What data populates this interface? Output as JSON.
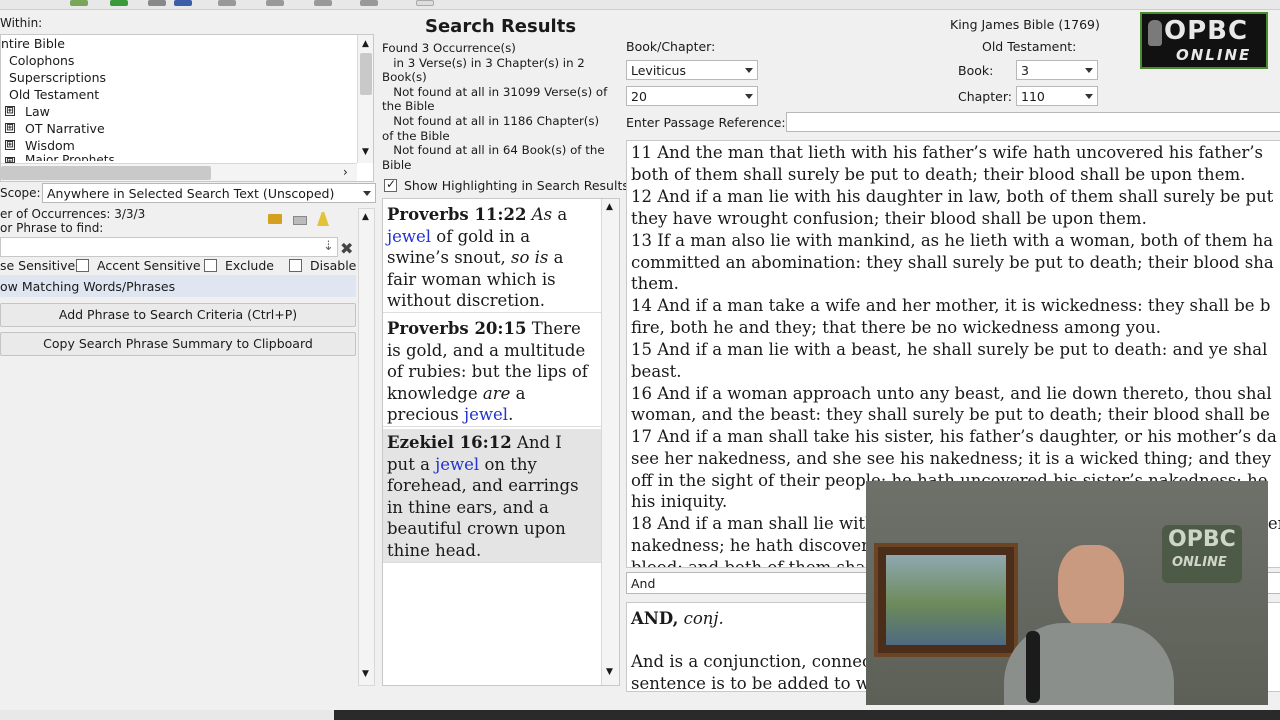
{
  "left": {
    "within_label": "Within:",
    "tree": [
      {
        "label": "ntire Bible",
        "marker": ""
      },
      {
        "label": "Colophons",
        "marker": ""
      },
      {
        "label": "Superscriptions",
        "marker": ""
      },
      {
        "label": "Old Testament",
        "marker": ""
      },
      {
        "label": "Law",
        "marker": "⊞"
      },
      {
        "label": "OT Narrative",
        "marker": "⊞"
      },
      {
        "label": "Wisdom",
        "marker": "⊞"
      },
      {
        "label": "Major Prophets",
        "marker": "⊞"
      }
    ],
    "scope_label": "Scope:",
    "scope_value": "Anywhere in Selected Search Text (Unscoped)",
    "occurrences_label": "er of Occurrences: 3/3/3",
    "phrase_label": "or Phrase to find:",
    "phrase_value": "",
    "options": {
      "case_sensitive": "se Sensitive",
      "accent_sensitive": "Accent Sensitive",
      "exclude": "Exclude",
      "disable": "Disable"
    },
    "matching_words": "ow Matching Words/Phrases",
    "add_phrase_button": "Add Phrase to Search Criteria (Ctrl+P)",
    "copy_summary_button": "Copy Search Phrase Summary to Clipboard"
  },
  "middle": {
    "title": "Search Results",
    "summary": [
      "Found 3 Occurrence(s)",
      "   in 3 Verse(s) in 3 Chapter(s) in 2",
      "Book(s)",
      "   Not found at all in 31099 Verse(s) of",
      "the Bible",
      "   Not found at all in 1186 Chapter(s)",
      "of the Bible",
      "   Not found at all in 64 Book(s) of the",
      "Bible"
    ],
    "show_highlighting": "Show Highlighting in Search Results",
    "results": [
      {
        "ref": "Proverbs 11:22",
        "lines": [
          [
            "",
            "As a"
          ],
          [
            "jewel",
            " of gold in a"
          ],
          [
            "",
            "swine’s snout, so is a"
          ],
          [
            "",
            "fair woman which is"
          ],
          [
            "",
            "without discretion."
          ]
        ]
      },
      {
        "ref": "Proverbs 20:15",
        "lines": [
          [
            "",
            "There"
          ],
          [
            "",
            "is gold, and a multitude"
          ],
          [
            "",
            "of rubies: but the lips of"
          ],
          [
            "",
            "knowledge are a"
          ],
          [
            "",
            "precious jewel."
          ]
        ]
      },
      {
        "ref": "Ezekiel 16:12",
        "lines": [
          [
            "",
            "And I"
          ],
          [
            "",
            "put a jewel on thy"
          ],
          [
            "",
            "forehead, and earrings"
          ],
          [
            "",
            "in thine ears, and a"
          ],
          [
            "",
            "beautiful crown upon"
          ],
          [
            "",
            "thine head."
          ]
        ]
      }
    ]
  },
  "right": {
    "version_title": "King James Bible (1769)",
    "book_chapter_label": "Book/Chapter:",
    "book_value": "Leviticus",
    "chapter_value": "20",
    "testament_label": "Old Testament:",
    "book_label": "Book:",
    "book_number": "3",
    "chapter_label": "Chapter:",
    "chapter_number": "110",
    "passage_label": "Enter Passage Reference:",
    "passage_value": "",
    "verses": [
      "11 And the man that lieth with his father’s wife hath uncovered his father’s",
      "both of them shall surely be put to death; their blood shall be upon them.",
      "12 And if a man lie with his daughter in law, both of them shall surely be put",
      "they have wrought confusion; their blood shall be upon them.",
      "13 If a man also lie with mankind, as he lieth with a woman, both of them ha",
      "committed an abomination: they shall surely be put to death; their blood sha",
      "them.",
      "14 And if a man take a wife and her mother, it is wickedness: they shall be b",
      "fire, both he and they; that there be no wickedness among you.",
      "15 And if a man lie with a beast, he shall surely be put to death: and ye shal",
      "beast.",
      "16 And if a woman approach unto any beast, and lie down thereto, thou shal",
      "woman, and the beast: they shall surely be put to death; their blood shall be",
      "17 And if a man shall take his sister, his father’s daughter, or his mother’s da",
      "see her nakedness, and she see his nakedness; it is a wicked thing; and they",
      "off in the sight of their people: he hath uncovered his sister’s nakedness; he",
      "his iniquity.",
      "18 And if a man shall lie with a woman having her sickness, and shall uncover",
      "nakedness; he hath discovered her fountain, and she hath uncovered the",
      "blood: and both of them shall be cut off"
    ],
    "dict_search": "And",
    "dict_headword": "AND,",
    "dict_pos": "conj.",
    "dict_body_1": "And is a conjunction, connecting words and sentences, and signifying that a",
    "dict_body_2": "sentence is to be added to what precedes."
  },
  "overlay": {
    "logo_line1": "OPBC",
    "logo_line2": "ONLINE"
  },
  "colors": {
    "highlight": "#2233cc",
    "logo_green": "#4a8c2a"
  }
}
